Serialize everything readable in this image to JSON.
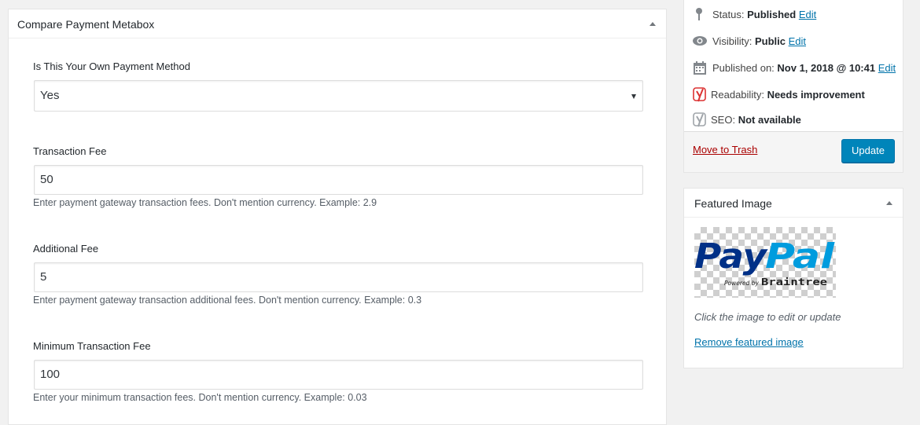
{
  "metabox": {
    "title": "Compare Payment Metabox",
    "fields": [
      {
        "label": "Is This Your Own Payment Method",
        "value": "Yes"
      },
      {
        "label": "Transaction Fee",
        "value": "50",
        "description": "Enter payment gateway transaction fees. Don't mention currency. Example: 2.9"
      },
      {
        "label": "Additional Fee",
        "value": "5",
        "description": "Enter payment gateway transaction additional fees. Don't mention currency. Example: 0.3"
      },
      {
        "label": "Minimum Transaction Fee",
        "value": "100",
        "description": "Enter your minimum transaction fees. Don't mention currency. Example: 0.03"
      }
    ]
  },
  "publish": {
    "status": {
      "label": "Status:",
      "value": "Published",
      "edit": "Edit"
    },
    "visibility": {
      "label": "Visibility:",
      "value": "Public",
      "edit": "Edit"
    },
    "published_on": {
      "label": "Published on:",
      "value": "Nov 1, 2018 @ 10:41",
      "edit": "Edit"
    },
    "readability": {
      "label": "Readability:",
      "value": "Needs improvement"
    },
    "seo": {
      "label": "SEO:",
      "value": "Not available"
    },
    "trash_label": "Move to Trash",
    "update_label": "Update"
  },
  "featured_image": {
    "title": "Featured Image",
    "logo_text": {
      "pay": "Pay",
      "pal": "Pal",
      "powered": "Powered by",
      "brand": "Braintree"
    },
    "hint": "Click the image to edit or update",
    "remove_label": "Remove featured image"
  },
  "colors": {
    "link": "#0073aa",
    "trash": "#aa0000",
    "button": "#0085ba",
    "paypal_dark": "#003087",
    "paypal_light": "#009cde",
    "yoast_red": "#dc3232"
  }
}
